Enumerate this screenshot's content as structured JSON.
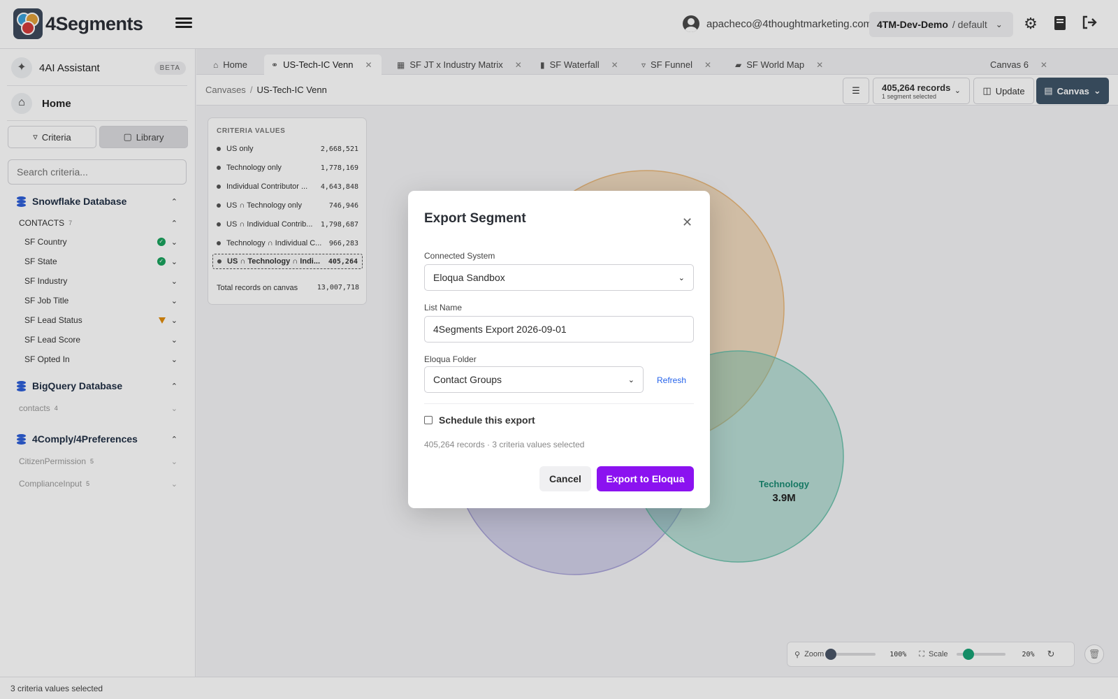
{
  "app": {
    "logo_text": "4Segments",
    "user_email": "apacheco@4thoughtmarketing.com",
    "workspace": "4TM-Dev-Demo",
    "workspace_scope": "/ default"
  },
  "sidebar": {
    "assistant_label": "4AI Assistant",
    "assistant_badge": "BETA",
    "home_label": "Home",
    "criteria_btn": "Criteria",
    "library_btn": "Library",
    "search_placeholder": "Search criteria...",
    "databases": [
      {
        "name": "Snowflake Database",
        "groups": [
          {
            "name": "CONTACTS",
            "count": "7",
            "items": [
              {
                "label": "SF Country",
                "status": "ok"
              },
              {
                "label": "SF State",
                "status": "ok"
              },
              {
                "label": "SF Industry",
                "status": ""
              },
              {
                "label": "SF Job Title",
                "status": ""
              },
              {
                "label": "SF Lead Status",
                "status": "filter"
              },
              {
                "label": "SF Lead Score",
                "status": ""
              },
              {
                "label": "SF Opted In",
                "status": ""
              }
            ]
          }
        ]
      },
      {
        "name": "BigQuery Database",
        "groups": [
          {
            "name": "contacts",
            "count": "4"
          }
        ]
      },
      {
        "name": "4Comply/4Preferences",
        "groups": [
          {
            "name": "CitizenPermission",
            "count": "5"
          },
          {
            "name": "ComplianceInput",
            "count": "5"
          }
        ]
      }
    ]
  },
  "tabs": [
    {
      "label": "Home",
      "icon": "home-icon"
    },
    {
      "label": "US-Tech-IC Venn",
      "icon": "venn-icon",
      "active": true
    },
    {
      "label": "SF JT x Industry Matrix",
      "icon": "grid-icon"
    },
    {
      "label": "SF Waterfall",
      "icon": "waterfall-icon"
    },
    {
      "label": "SF Funnel",
      "icon": "funnel-icon"
    },
    {
      "label": "SF World Map",
      "icon": "map-icon"
    },
    {
      "label": "Canvas 6",
      "icon": ""
    }
  ],
  "toolbar": {
    "crumb_root": "Canvases",
    "crumb_current": "US-Tech-IC Venn",
    "records_count": "405,264 records",
    "records_sub": "1 segment selected",
    "update_label": "Update",
    "canvas_label": "Canvas"
  },
  "criteria_panel": {
    "title": "CRITERIA VALUES",
    "rows": [
      {
        "label": "US only",
        "value": "2,668,521"
      },
      {
        "label": "Technology only",
        "value": "1,778,169"
      },
      {
        "label": "Individual Contributor ...",
        "value": "4,643,848"
      },
      {
        "label": "US ∩ Technology only",
        "value": "746,946"
      },
      {
        "label": "US ∩ Individual Contrib...",
        "value": "1,798,687"
      },
      {
        "label": "Technology ∩ Individual C...",
        "value": "966,283"
      },
      {
        "label": "US ∩ Technology ∩ Indi...",
        "value": "405,264",
        "selected": true
      }
    ],
    "total_label": "Total records on canvas",
    "total_value": "13,007,718"
  },
  "venn": {
    "technology_label": "Technology",
    "technology_value": "3.9M",
    "colors": {
      "us": "#e8b77a",
      "technology": "#6fc2ad",
      "individual": "#a8a3d8"
    }
  },
  "zoom_bar": {
    "zoom_label": "Zoom",
    "zoom_value": "100%",
    "scale_label": "Scale",
    "scale_value": "20%",
    "zoom_level": 0,
    "scale_level": 0.25
  },
  "status_bar": "3 criteria values selected",
  "modal": {
    "title": "Export Segment",
    "connected_system_label": "Connected System",
    "connected_system_value": "Eloqua Sandbox",
    "list_name_label": "List Name",
    "list_name_value": "4Segments Export 2026-09-01",
    "folder_label": "Eloqua Folder",
    "folder_value": "Contact Groups",
    "refresh_label": "Refresh",
    "schedule_label": "Schedule this export",
    "summary": "405,264 records · 3 criteria values selected",
    "cancel_label": "Cancel",
    "export_label": "Export to Eloqua",
    "accent": "#8b12f0"
  }
}
